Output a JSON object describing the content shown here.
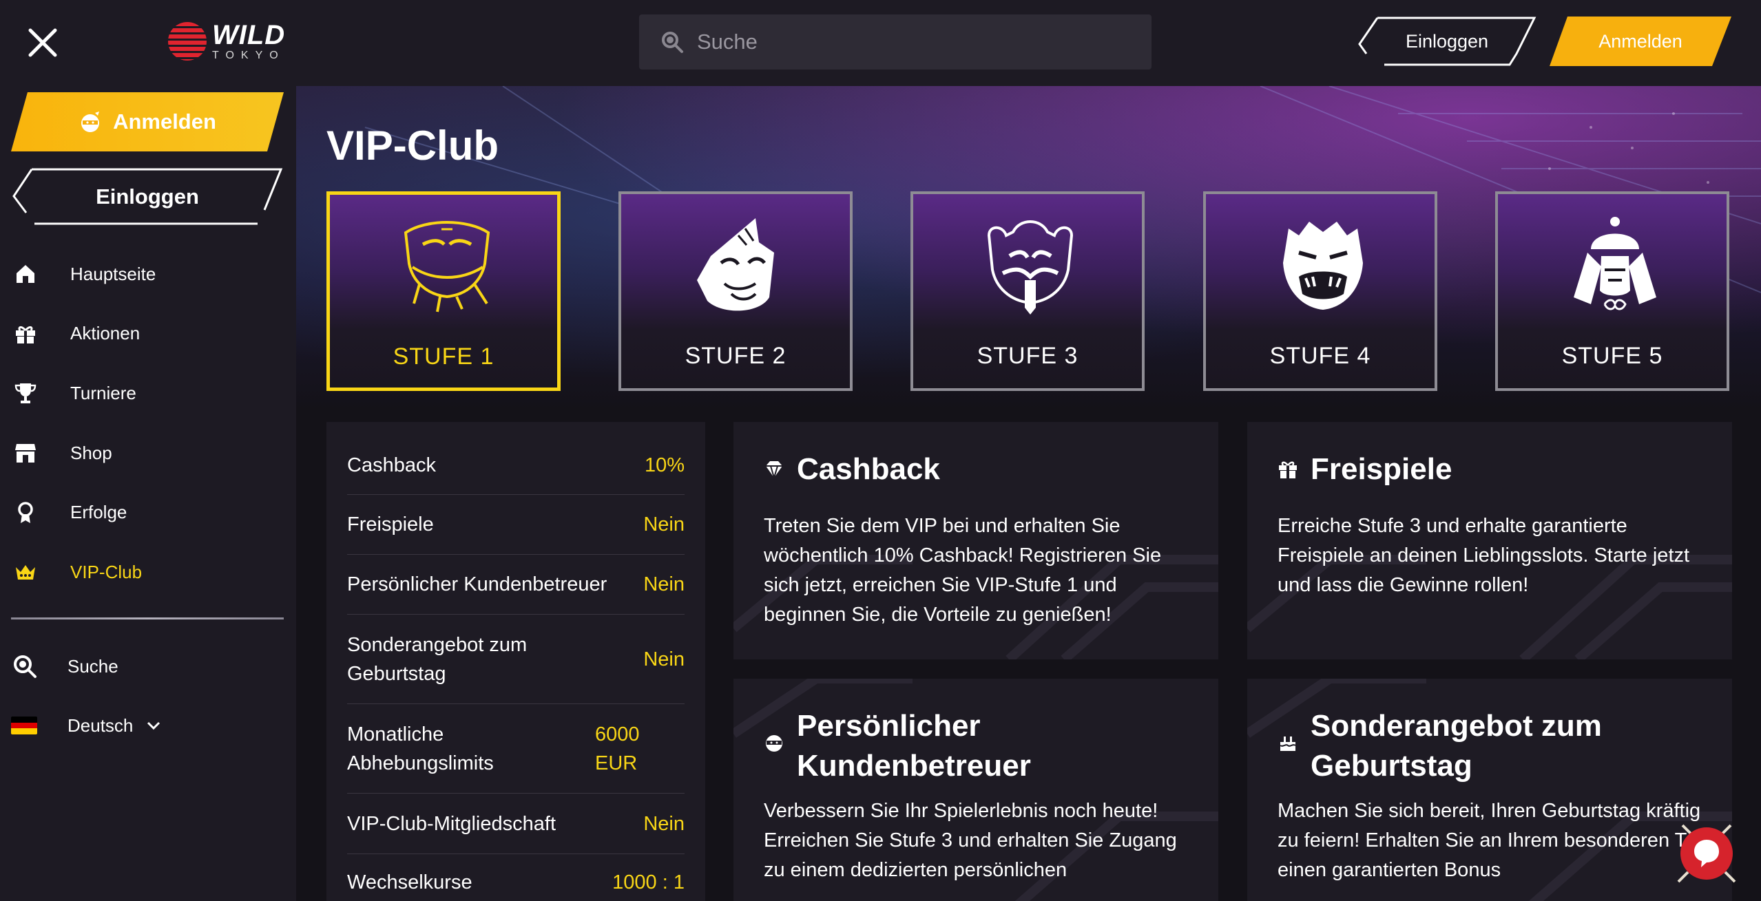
{
  "header": {
    "logo_word": "WILD",
    "logo_sub": "TOKYO",
    "search_placeholder": "Suche",
    "login_label": "Einloggen",
    "signup_label": "Anmelden"
  },
  "sidebar": {
    "signup_label": "Anmelden",
    "login_label": "Einloggen",
    "items": [
      {
        "label": "Hauptseite",
        "icon": "home-icon",
        "active": false
      },
      {
        "label": "Aktionen",
        "icon": "gift-icon",
        "active": false
      },
      {
        "label": "Turniere",
        "icon": "trophy-icon",
        "active": false
      },
      {
        "label": "Shop",
        "icon": "shop-icon",
        "active": false
      },
      {
        "label": "Erfolge",
        "icon": "award-icon",
        "active": false
      },
      {
        "label": "VIP-Club",
        "icon": "crown-icon",
        "active": true
      }
    ],
    "search_label": "Suche",
    "language_label": "Deutsch"
  },
  "main": {
    "title": "VIP-Club",
    "tiers": [
      {
        "label": "STUFE 1",
        "active": true
      },
      {
        "label": "STUFE 2",
        "active": false
      },
      {
        "label": "STUFE 3",
        "active": false
      },
      {
        "label": "STUFE 4",
        "active": false
      },
      {
        "label": "STUFE 5",
        "active": false
      }
    ],
    "benefits": [
      {
        "key": "Cashback",
        "value": "10%"
      },
      {
        "key": "Freispiele",
        "value": "Nein"
      },
      {
        "key": "Persönlicher Kundenbetreuer",
        "value": "Nein"
      },
      {
        "key": "Sonderangebot zum Geburtstag",
        "value": "Nein"
      },
      {
        "key": "Monatliche Abhebungslimits",
        "value": "6000 EUR"
      },
      {
        "key": "VIP-Club-Mitgliedschaft",
        "value": "Nein"
      },
      {
        "key": "Wechselkurse",
        "value": "1000 : 1"
      }
    ],
    "cards": [
      {
        "title": "Cashback",
        "text": "Treten Sie dem VIP bei und erhalten Sie wöchentlich 10% Cashback! Registrieren Sie sich jetzt, erreichen Sie VIP-Stufe 1 und beginnen Sie, die Vorteile zu genießen!"
      },
      {
        "title": "Freispiele",
        "text": "Erreiche Stufe 3 und erhalte garantierte Freispiele an deinen Lieblingsslots. Starte jetzt und lass die Gewinne rollen!"
      },
      {
        "title": "Persönlicher Kundenbetreuer",
        "text": "Verbessern Sie Ihr Spielerlebnis noch heute! Erreichen Sie Stufe 3 und erhalten Sie Zugang zu einem dedizierten persönlichen"
      },
      {
        "title": "Sonderangebot zum Geburtstag",
        "text": "Machen Sie sich bereit, Ihren Geburtstag kräftig zu feiern! Erhalten Sie an Ihrem besonderen Tag einen garantierten Bonus"
      }
    ]
  },
  "colors": {
    "accent": "#f9d616",
    "orange": "#f7a80e",
    "panel": "#1e1b24",
    "chat": "#d6232c"
  }
}
